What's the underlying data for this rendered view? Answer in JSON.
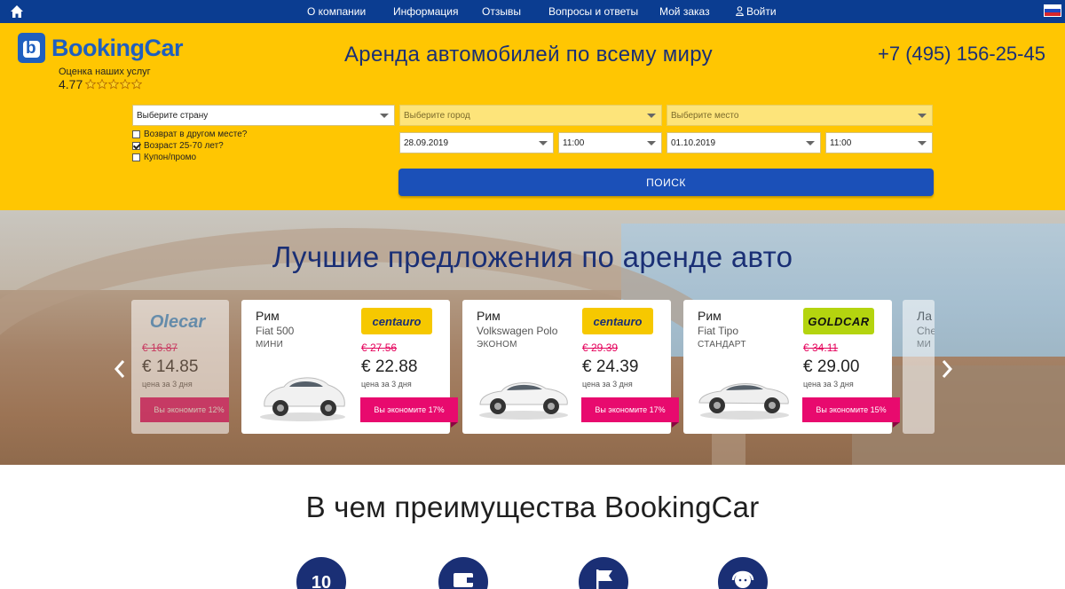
{
  "nav": {
    "items": [
      "О компании",
      "Информация",
      "Отзывы",
      "Вопросы и ответы",
      "Мой заказ",
      "Войти"
    ]
  },
  "header": {
    "brand": "BookingCar",
    "rating_caption": "Оценка наших услуг",
    "rating_value": "4.77",
    "stars": 5,
    "headline": "Аренда автомобилей по всему миру",
    "phone": "+7 (495) 156-25-45"
  },
  "search": {
    "country_placeholder": "Выберите страну",
    "city_placeholder": "Выберите город",
    "place_placeholder": "Выберите место",
    "pickup_date": "28.09.2019",
    "pickup_time": "11:00",
    "return_date": "01.10.2019",
    "return_time": "11:00",
    "options": [
      {
        "label": "Возврат в другом месте?",
        "checked": false
      },
      {
        "label": "Возраст 25-70 лет?",
        "checked": true
      },
      {
        "label": "Купон/промо",
        "checked": false
      }
    ],
    "submit_label": "ПОИСК"
  },
  "hero": {
    "title": "Лучшие предложения по аренде авто",
    "offers": [
      {
        "city": "",
        "model": "",
        "class": "",
        "brand": "Olecar",
        "old_price": "€ 16.87",
        "price": "€ 14.85",
        "per": "цена за 3 дня",
        "save": "Вы экономите 12%"
      },
      {
        "city": "Рим",
        "model": "Fiat 500",
        "class": "МИНИ",
        "brand": "centauro",
        "old_price": "€ 27.56",
        "price": "€ 22.88",
        "per": "цена за 3 дня",
        "save": "Вы экономите 17%"
      },
      {
        "city": "Рим",
        "model": "Volkswagen Polo",
        "class": "ЭКОНОМ",
        "brand": "centauro",
        "old_price": "€ 29.39",
        "price": "€ 24.39",
        "per": "цена за 3 дня",
        "save": "Вы экономите 17%"
      },
      {
        "city": "Рим",
        "model": "Fiat Tipo",
        "class": "СТАНДАРТ",
        "brand": "GOLDCAR",
        "old_price": "€ 34.11",
        "price": "€ 29.00",
        "per": "цена за 3 дня",
        "save": "Вы экономите 15%"
      },
      {
        "city": "Ла",
        "model": "Che",
        "class": "МИ",
        "brand": "",
        "old_price": "",
        "price": "",
        "per": "",
        "save": ""
      }
    ]
  },
  "advantages": {
    "title": "В чем преимущества BookingCar",
    "items": [
      {
        "icon": "number-10-icon",
        "text": "10"
      },
      {
        "icon": "wallet-icon",
        "text": ""
      },
      {
        "icon": "flag-icon",
        "text": ""
      },
      {
        "icon": "support-agent-icon",
        "text": ""
      }
    ]
  },
  "colors": {
    "nav_bg": "#0b3d91",
    "header_bg": "#ffc602",
    "accent_blue": "#1b50b8",
    "discount_pink": "#e80a6e"
  }
}
